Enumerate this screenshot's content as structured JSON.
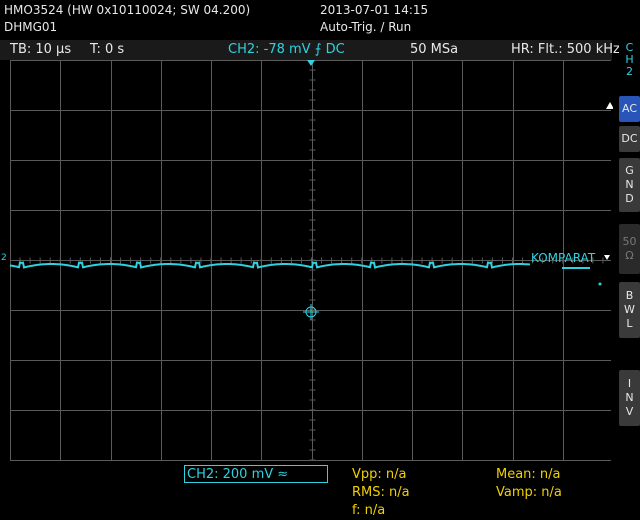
{
  "header": {
    "device_line": "HMO3524 (HW 0x10110024; SW 04.200)",
    "device_name": "DHMG01",
    "datetime": "2013-07-01 14:15",
    "trigger_status": "Auto-Trig. / Run"
  },
  "status_bar": {
    "timebase": "TB: 10 µs",
    "trigger_time": "T: 0 s",
    "channel_setting": "CH2: -78 mV ⨍ DC",
    "sample_rate": "50 MSa",
    "resolution": "HR: Flt.: 500 kHz"
  },
  "graticule": {
    "channel_marker": "2",
    "trace_label": "KOMPARAT",
    "colors": {
      "trace": "#2fd2e0",
      "grid": "#5a5a5a",
      "background": "#000000"
    }
  },
  "side_menu": {
    "channel": [
      "C",
      "H",
      "2"
    ],
    "buttons": [
      {
        "label": [
          "AC"
        ],
        "active": true
      },
      {
        "label": [
          "DC"
        ],
        "active": false
      },
      {
        "label": [
          "G",
          "N",
          "D"
        ],
        "active": false
      },
      {
        "label": [
          "50",
          "Ω"
        ],
        "active": false,
        "disabled": true
      },
      {
        "label": [
          "B",
          "W",
          "L"
        ],
        "active": false
      },
      {
        "label": [
          "I",
          "N",
          "V"
        ],
        "active": false
      }
    ]
  },
  "footer": {
    "channel_scale": "CH2: 200 mV ≈",
    "vpp": "Vpp: n/a",
    "rms": "RMS: n/a",
    "freq": "f: n/a",
    "mean": "Mean: n/a",
    "vamp": "Vamp: n/a"
  }
}
